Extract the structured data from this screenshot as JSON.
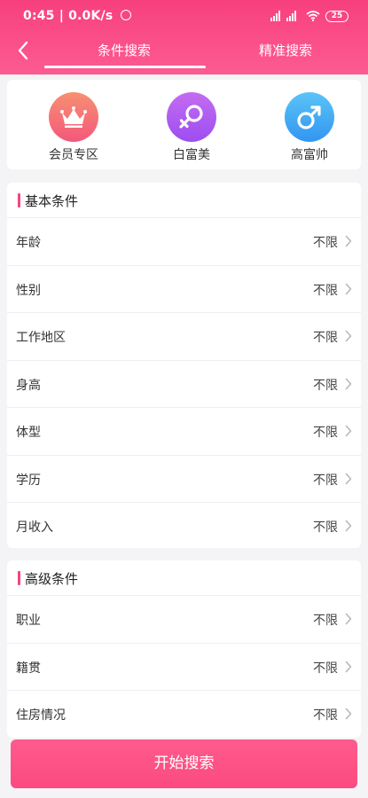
{
  "status": {
    "time": "0:45",
    "speed": "0.0K/s",
    "battery": "25"
  },
  "nav": {
    "tabs": [
      "条件搜索",
      "精准搜索"
    ],
    "active_tab": "条件搜索"
  },
  "categories": [
    {
      "label": "会员专区",
      "icon": "crown-icon"
    },
    {
      "label": "白富美",
      "icon": "female-symbol-icon"
    },
    {
      "label": "高富帅",
      "icon": "male-symbol-icon"
    }
  ],
  "basic": {
    "title": "基本条件",
    "rows": [
      {
        "label": "年龄",
        "value": "不限"
      },
      {
        "label": "性别",
        "value": "不限"
      },
      {
        "label": "工作地区",
        "value": "不限"
      },
      {
        "label": "身高",
        "value": "不限"
      },
      {
        "label": "体型",
        "value": "不限"
      },
      {
        "label": "学历",
        "value": "不限"
      },
      {
        "label": "月收入",
        "value": "不限"
      }
    ]
  },
  "advanced": {
    "title": "高级条件",
    "rows": [
      {
        "label": "职业",
        "value": "不限"
      },
      {
        "label": "籍贯",
        "value": "不限"
      },
      {
        "label": "住房情况",
        "value": "不限"
      }
    ]
  },
  "action": {
    "start_label": "开始搜索"
  },
  "colors": {
    "brand_pink": "#f7407e",
    "vip": "#f4577b",
    "female": "#9c4ef0",
    "male": "#3296f1"
  }
}
